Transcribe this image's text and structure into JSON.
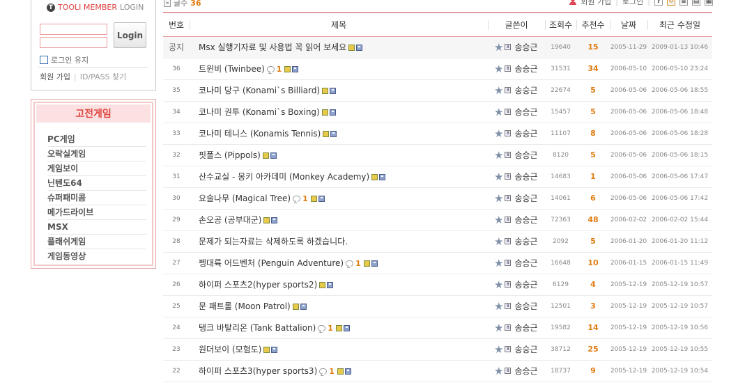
{
  "login": {
    "brand": "TOOLI MEMBER",
    "login_word": "LOGIN",
    "button_label": "Login",
    "keep_login_label": "로그인 유지",
    "join_link": "회원 가입",
    "find_link": "ID/PASS 찾기"
  },
  "categories": {
    "title": "고전게임",
    "items": [
      "PC게임",
      "오락실게임",
      "게임보이",
      "닌텐도64",
      "슈퍼패미콤",
      "메가드라이브",
      "MSX",
      "플래쉬게임",
      "게임동영상"
    ]
  },
  "topbar": {
    "count_label": "글수",
    "count_value": "36",
    "join_link": "회원 가입",
    "login_link": "로그인",
    "help_icon": "?"
  },
  "board": {
    "columns": [
      "번호",
      "제목",
      "글쓴이",
      "조회수",
      "추천수",
      "날짜",
      "최근 수정일"
    ],
    "rows": [
      {
        "num": "공지",
        "title": "Msx 실행기자료 및 사용법 꼭 읽어 보세요",
        "comments": "",
        "writer": "송승근",
        "views": "19640",
        "votes": "15",
        "date": "2005-11-29",
        "edited": "2009-01-13 10:46",
        "notice": true
      },
      {
        "num": "36",
        "title": "트윈비 (Twinbee)",
        "comments": "1",
        "writer": "송승근",
        "views": "31531",
        "votes": "34",
        "date": "2006-05-10",
        "edited": "2006-05-10 23:24",
        "notice": false
      },
      {
        "num": "35",
        "title": "코나미 당구 (Konami`s Billiard)",
        "comments": "",
        "writer": "송승근",
        "views": "22674",
        "votes": "5",
        "date": "2006-05-06",
        "edited": "2006-05-06 18:55",
        "notice": false
      },
      {
        "num": "34",
        "title": "코나미 권투 (Konami`s Boxing)",
        "comments": "",
        "writer": "송승근",
        "views": "15457",
        "votes": "5",
        "date": "2006-05-06",
        "edited": "2006-05-06 18:48",
        "notice": false
      },
      {
        "num": "33",
        "title": "코나미 테니스 (Konamis Tennis)",
        "comments": "",
        "writer": "송승근",
        "views": "11107",
        "votes": "8",
        "date": "2006-05-06",
        "edited": "2006-05-06 18:28",
        "notice": false
      },
      {
        "num": "32",
        "title": "핏폴스 (Pippols)",
        "comments": "",
        "writer": "송승근",
        "views": "8120",
        "votes": "5",
        "date": "2006-05-06",
        "edited": "2006-05-06 18:15",
        "notice": false
      },
      {
        "num": "31",
        "title": "산수교실 - 몽키 아카데미 (Monkey Academy)",
        "comments": "",
        "writer": "송승근",
        "views": "14683",
        "votes": "1",
        "date": "2006-05-06",
        "edited": "2006-05-06 17:47",
        "notice": false
      },
      {
        "num": "30",
        "title": "요술나무 (Magical Tree)",
        "comments": "1",
        "writer": "송승근",
        "views": "14061",
        "votes": "6",
        "date": "2006-05-06",
        "edited": "2006-05-06 17:42",
        "notice": false
      },
      {
        "num": "29",
        "title": "손오공 (공부대군)",
        "comments": "",
        "writer": "송승근",
        "views": "72363",
        "votes": "48",
        "date": "2006-02-02",
        "edited": "2006-02-02 15:44",
        "notice": false
      },
      {
        "num": "28",
        "title": "문제가 되는자료는 삭제하도록 하겠습니다.",
        "comments": "",
        "writer": "송승근",
        "views": "2092",
        "votes": "5",
        "date": "2006-01-20",
        "edited": "2006-01-20 11:12",
        "notice": false,
        "no_icons": true
      },
      {
        "num": "27",
        "title": "펭대륙 어드벤처 (Penguin Adventure)",
        "comments": "1",
        "writer": "송승근",
        "views": "16648",
        "votes": "10",
        "date": "2006-01-15",
        "edited": "2006-01-15 11:49",
        "notice": false
      },
      {
        "num": "26",
        "title": "하이퍼 스포츠2(hyper sports2)",
        "comments": "",
        "writer": "송승근",
        "views": "6129",
        "votes": "4",
        "date": "2005-12-19",
        "edited": "2005-12-19 10:57",
        "notice": false
      },
      {
        "num": "25",
        "title": "문 패트롤 (Moon Patrol)",
        "comments": "",
        "writer": "송승근",
        "views": "12501",
        "votes": "3",
        "date": "2005-12-19",
        "edited": "2005-12-19 10:57",
        "notice": false
      },
      {
        "num": "24",
        "title": "탱크 바탈리온 (Tank Battalion)",
        "comments": "1",
        "writer": "송승근",
        "views": "19582",
        "votes": "14",
        "date": "2005-12-19",
        "edited": "2005-12-19 10:56",
        "notice": false
      },
      {
        "num": "23",
        "title": "원더보이 (모험도)",
        "comments": "",
        "writer": "송승근",
        "views": "38712",
        "votes": "25",
        "date": "2005-12-19",
        "edited": "2005-12-19 10:55",
        "notice": false
      },
      {
        "num": "22",
        "title": "하이퍼 스포츠3(hyper sports3)",
        "comments": "1",
        "writer": "송승근",
        "views": "18737",
        "votes": "9",
        "date": "2005-12-19",
        "edited": "2005-12-19 10:54",
        "notice": false
      }
    ]
  }
}
